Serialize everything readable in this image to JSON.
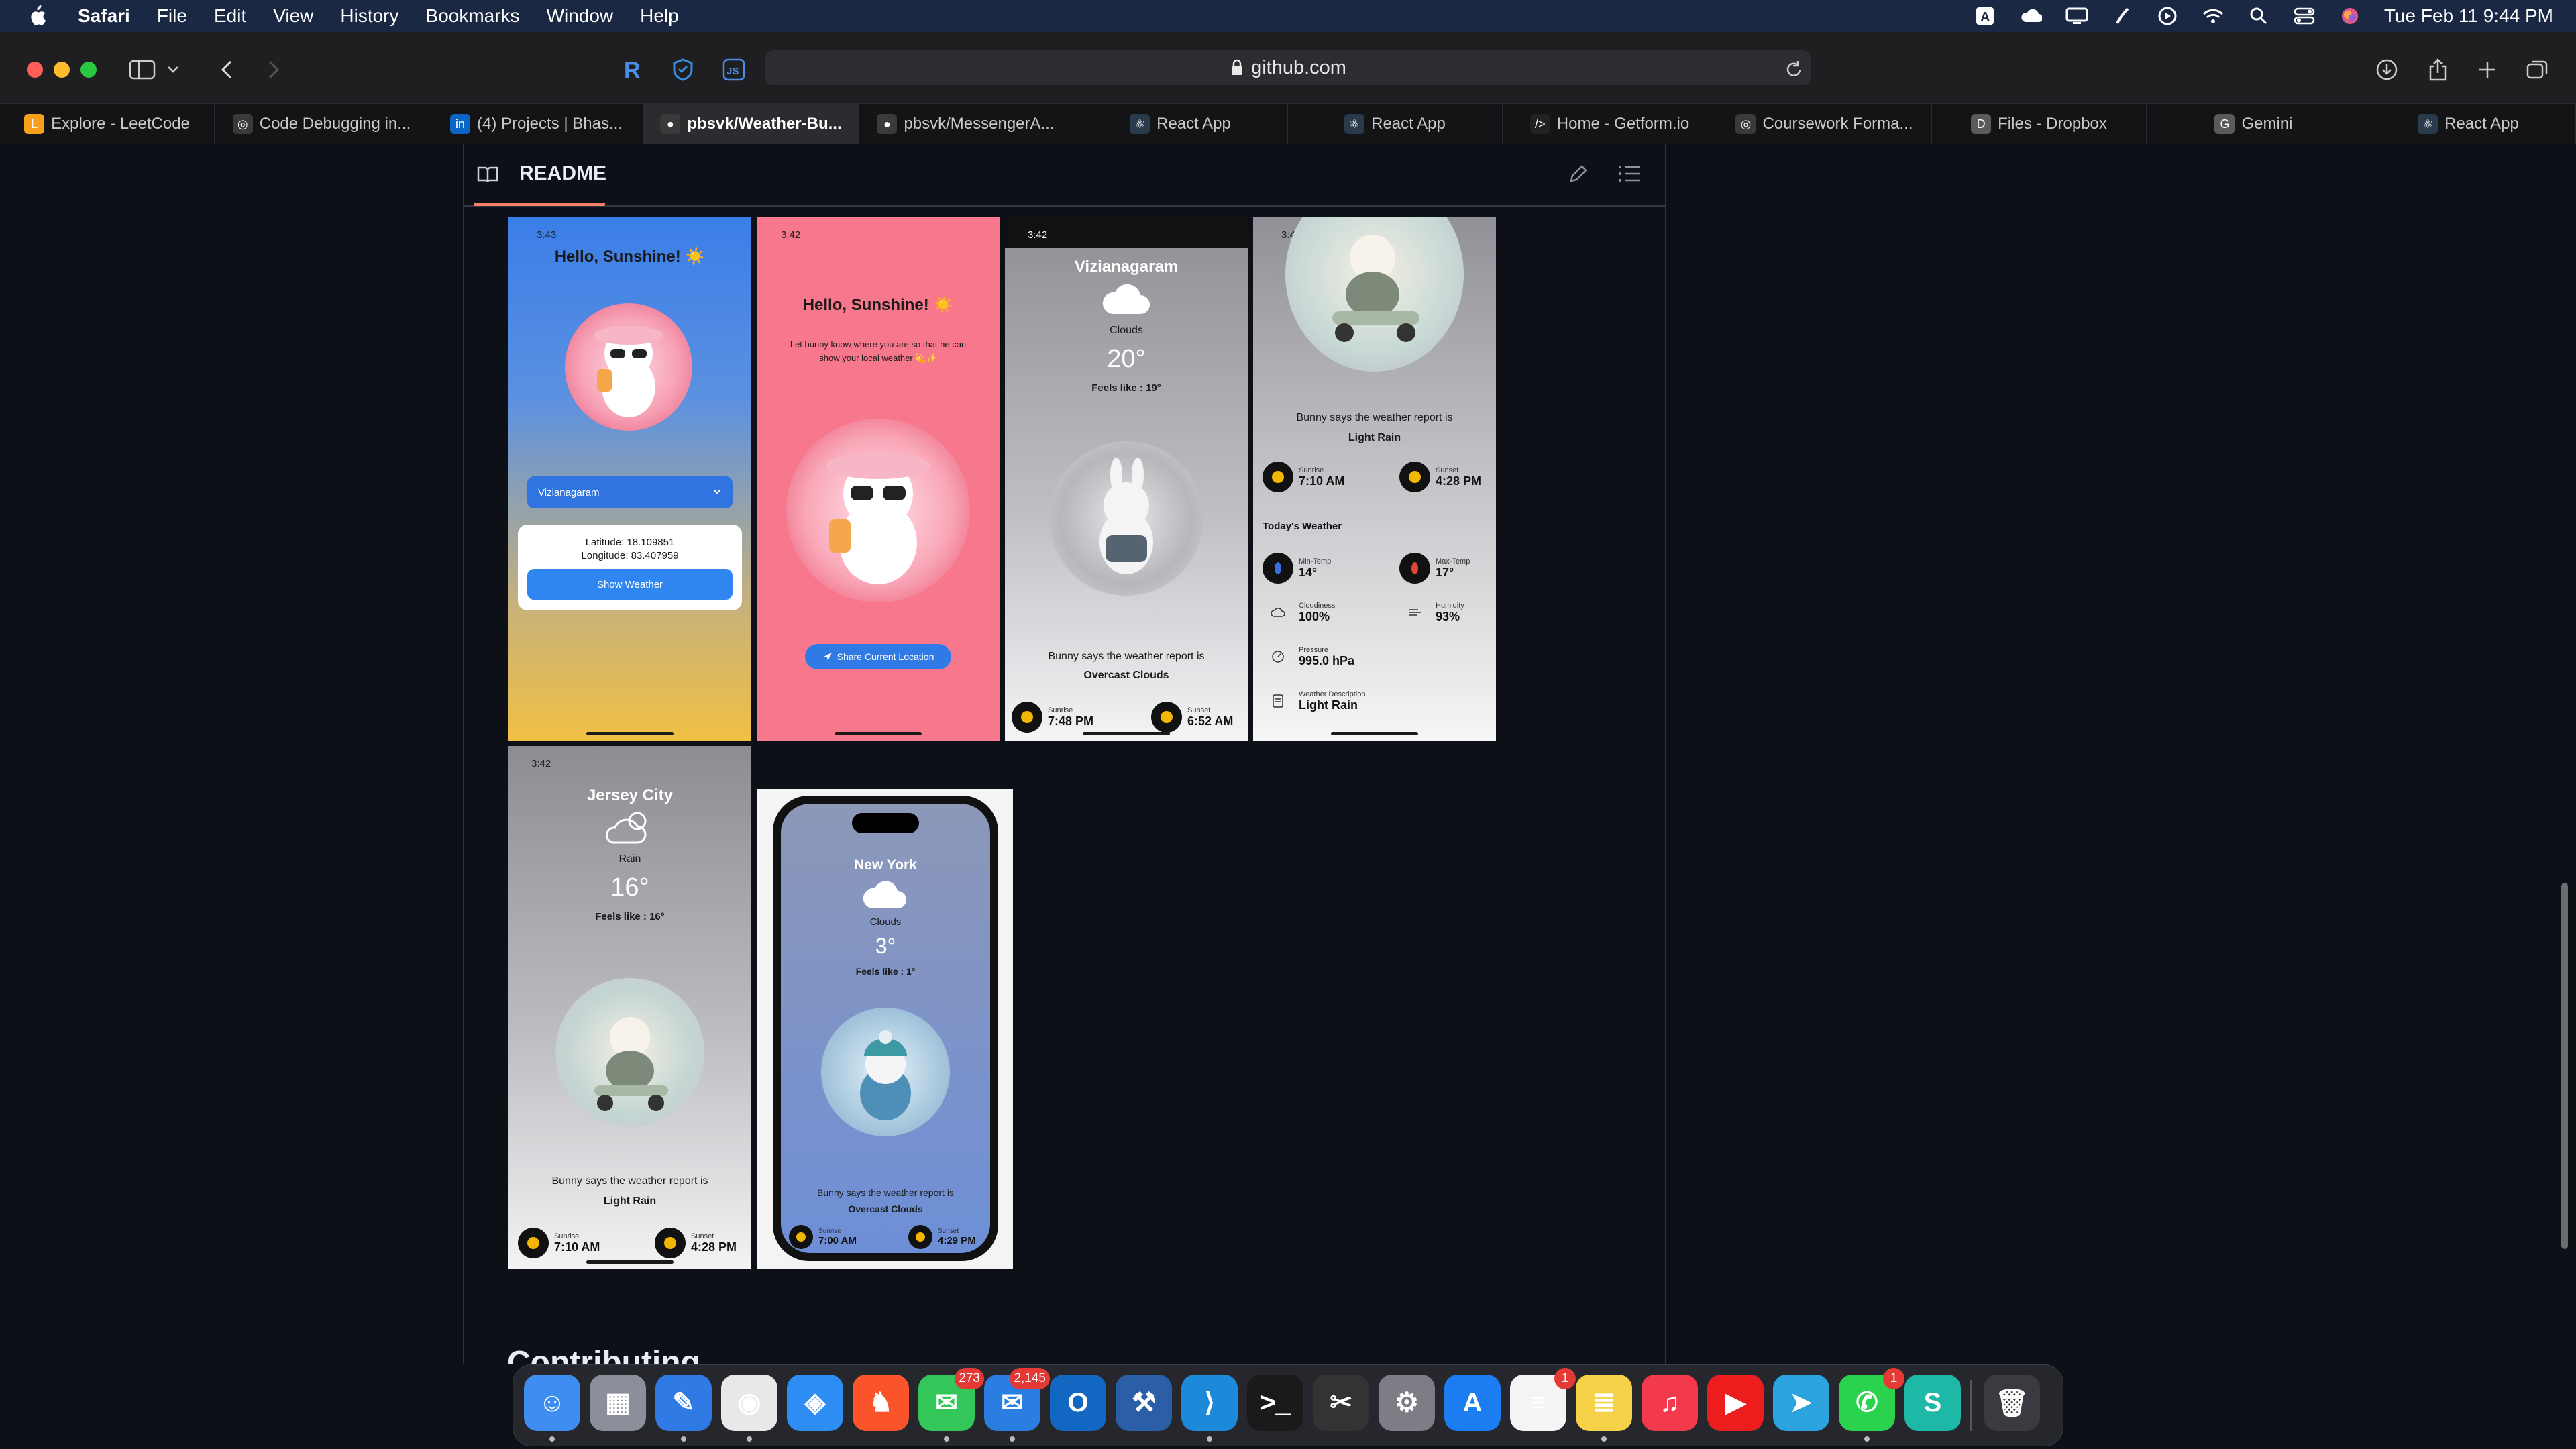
{
  "menubar": {
    "app": "Safari",
    "items": [
      "File",
      "Edit",
      "View",
      "History",
      "Bookmarks",
      "Window",
      "Help"
    ],
    "clock": "Tue Feb 11  9:44 PM"
  },
  "browser": {
    "url": "github.com",
    "tabs": [
      {
        "label": "Explore - LeetCode",
        "icon": "leetcode-icon",
        "color": "#f89f1b"
      },
      {
        "label": "Code Debugging in...",
        "icon": "openai-icon",
        "color": "#3a3a3a"
      },
      {
        "label": "(4) Projects | Bhas...",
        "icon": "linkedin-icon",
        "color": "#0a66c2"
      },
      {
        "label": "pbsvk/Weather-Bu...",
        "icon": "github-icon",
        "color": "#3a3a3a"
      },
      {
        "label": "pbsvk/MessengerA...",
        "icon": "github-icon",
        "color": "#3a3a3a"
      },
      {
        "label": "React App",
        "icon": "react-icon",
        "color": "#2a3a4a"
      },
      {
        "label": "React App",
        "icon": "react-icon",
        "color": "#2a3a4a"
      },
      {
        "label": "Home - Getform.io",
        "icon": "getform-icon",
        "color": "#222"
      },
      {
        "label": "Coursework Forma...",
        "icon": "openai-icon",
        "color": "#3a3a3a"
      },
      {
        "label": "Files - Dropbox",
        "icon": "dropbox-icon",
        "color": "#5a5a5a"
      },
      {
        "label": "Gemini",
        "icon": "gemini-icon",
        "color": "#5a5a5a"
      },
      {
        "label": "React App",
        "icon": "react-icon",
        "color": "#2a3a4a"
      }
    ]
  },
  "readme": {
    "title": "README",
    "contributing": "Contributing"
  },
  "screens": {
    "s1": {
      "time": "3:43",
      "greeting": "Hello, Sunshine! ☀️",
      "dropdown": "Vizianagaram",
      "latitude": "Latitude: 18.109851",
      "longitude": "Longitude: 83.407959",
      "button": "Show Weather"
    },
    "s2": {
      "time": "3:42",
      "greeting": "Hello, Sunshine! ☀️",
      "message": "Let bunny know where you are so that he can show your local weather 💫✨",
      "button": "Share Current Location"
    },
    "s3": {
      "time": "3:42",
      "city": "Vizianagaram",
      "condition": "Clouds",
      "temp": "20°",
      "feels": "Feels like :  19°",
      "report": "Bunny says the weather report is",
      "report_value": "Overcast Clouds",
      "sunrise_label": "Sunrise",
      "sunrise": "7:48 PM",
      "sunset_label": "Sunset",
      "sunset": "6:52 AM"
    },
    "s4": {
      "time": "3:42",
      "report": "Bunny says the weather report is",
      "report_value": "Light Rain",
      "sunrise_label": "Sunrise",
      "sunrise": "7:10 AM",
      "sunset_label": "Sunset",
      "sunset": "4:28 PM",
      "today": "Today's Weather",
      "min_label": "Min-Temp",
      "min": "14°",
      "max_label": "Max-Temp",
      "max": "17°",
      "cloud_label": "Cloudiness",
      "cloud": "100%",
      "hum_label": "Humidity",
      "hum": "93%",
      "press_label": "Pressure",
      "press": "995.0 hPa",
      "desc_label": "Weather Description",
      "desc": "Light Rain"
    },
    "s5": {
      "time": "3:42",
      "city": "Jersey City",
      "condition": "Rain",
      "temp": "16°",
      "feels": "Feels like :  16°",
      "report": "Bunny says the weather report is",
      "report_value": "Light Rain",
      "sunrise_label": "Sunrise",
      "sunrise": "7:10 AM",
      "sunset_label": "Sunset",
      "sunset": "4:28 PM"
    },
    "s6": {
      "city": "New York",
      "condition": "Clouds",
      "temp": "3°",
      "feels": "Feels like :  1°",
      "report": "Bunny says the weather report is",
      "report_value": "Overcast Clouds",
      "sunrise_label": "Sunrise",
      "sunrise": "7:00 AM",
      "sunset_label": "Sunset",
      "sunset": "4:29 PM"
    }
  },
  "dock": {
    "apps": [
      {
        "name": "finder-icon",
        "color": "#3d8ef0",
        "glyph": "☺"
      },
      {
        "name": "launchpad-icon",
        "color": "#8a8f99",
        "glyph": "▦"
      },
      {
        "name": "xcode-icon",
        "color": "#2f7ae5",
        "glyph": "✎"
      },
      {
        "name": "chrome-icon",
        "color": "#e8e8e8",
        "glyph": "◉"
      },
      {
        "name": "safari-icon",
        "color": "#2e8df2",
        "glyph": "◈"
      },
      {
        "name": "brave-icon",
        "color": "#fb542b",
        "glyph": "♞"
      },
      {
        "name": "messages-icon",
        "color": "#33c759",
        "glyph": "✉",
        "badge": "273"
      },
      {
        "name": "mail-icon",
        "color": "#2a7de1",
        "glyph": "✉",
        "badge": "2,145"
      },
      {
        "name": "outlook-icon",
        "color": "#1267c2",
        "glyph": "O"
      },
      {
        "name": "simulator-icon",
        "color": "#2a5fa8",
        "glyph": "⚒"
      },
      {
        "name": "vscode-icon",
        "color": "#1c8ad8",
        "glyph": "⟩"
      },
      {
        "name": "terminal-icon",
        "color": "#1a1a1a",
        "glyph": ">_"
      },
      {
        "name": "final-cut-icon",
        "color": "#333",
        "glyph": "✂"
      },
      {
        "name": "system-settings-icon",
        "color": "#7d7d85",
        "glyph": "⚙"
      },
      {
        "name": "app-store-icon",
        "color": "#1c7cf2",
        "glyph": "A"
      },
      {
        "name": "reminders-icon",
        "color": "#f4f4f4",
        "glyph": "≡",
        "badge": "1"
      },
      {
        "name": "notes-icon",
        "color": "#f6d248",
        "glyph": "≣"
      },
      {
        "name": "music-icon",
        "color": "#f23a4c",
        "glyph": "♫"
      },
      {
        "name": "youtube-icon",
        "color": "#ee1d1d",
        "glyph": "▶"
      },
      {
        "name": "telegram-icon",
        "color": "#2aa3df",
        "glyph": "➤"
      },
      {
        "name": "whatsapp-icon",
        "color": "#2bd24e",
        "glyph": "✆",
        "badge": "1"
      },
      {
        "name": "surfshark-icon",
        "color": "#1eb8a6",
        "glyph": "S"
      },
      {
        "name": "trash-icon",
        "color": "#3a3a40",
        "glyph": "🗑"
      }
    ]
  }
}
